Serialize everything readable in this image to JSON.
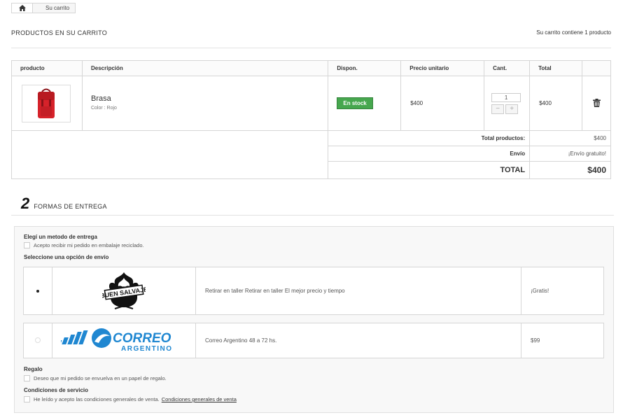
{
  "breadcrumb": {
    "home_icon": "home-icon",
    "current": "Su carrito"
  },
  "heading": {
    "title": "PRODUCTOS EN SU CARRITO",
    "count_text": "Su carrito contiene 1 producto"
  },
  "cart_table": {
    "headers": [
      "producto",
      "Descripción",
      "Dispon.",
      "Precio unitario",
      "Cant.",
      "Total",
      ""
    ],
    "item": {
      "name": "Brasa",
      "attributes": "Color : Rojo",
      "availability": "En stock",
      "unit_price": "$400",
      "quantity": "1",
      "total": "$400",
      "delete_icon": "trash-icon"
    },
    "summary": {
      "products_label": "Total productos:",
      "products_value": "$400",
      "shipping_label": "Envío",
      "shipping_value": "¡Envío gratuito!",
      "total_label": "TOTAL",
      "total_value": "$400"
    }
  },
  "delivery": {
    "step_number": "2",
    "step_title": "FORMAS DE ENTREGA",
    "choose_label": "Elegí un metodo de entrega",
    "recycled_label": "Acepto recibir mi pedido en embalaje reciclado.",
    "select_label": "Seleccione una opción de envío",
    "options": [
      {
        "logo_text": "BUEN SALVAJE",
        "description": "Retirar en taller Retirar en taller El mejor precio y tiempo",
        "price": "¡Gratis!",
        "selected": true
      },
      {
        "logo_text_1": "CORREO",
        "logo_text_2": "ARGENTINO",
        "description": "Correo Argentino 48 a 72 hs.",
        "price": "$99",
        "selected": false
      }
    ],
    "gift_label": "Regalo",
    "gift_check_label": "Deseo que mi pedido se envuelva en un papel de regalo.",
    "tos_label": "Condiciones de servicio",
    "tos_check_label": "He leído y acepto las condiciones generales de venta.",
    "tos_link": "Condiciones generales de venta"
  },
  "colors": {
    "stock_green": "#46a74e",
    "correo_blue": "#1f87d1"
  }
}
